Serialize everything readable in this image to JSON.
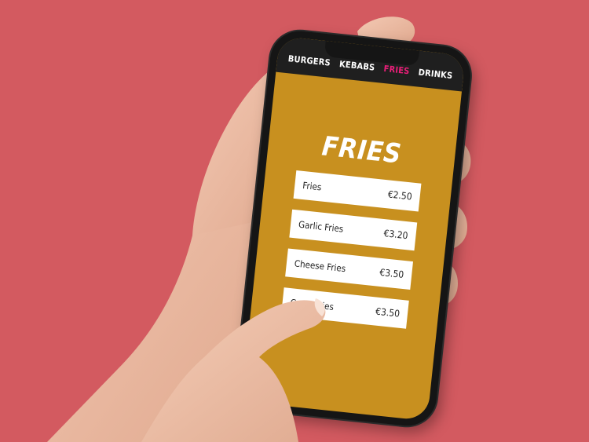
{
  "nav": {
    "items": [
      {
        "label": "BURGERS",
        "active": false
      },
      {
        "label": "KEBABS",
        "active": false
      },
      {
        "label": "FRIES",
        "active": true
      },
      {
        "label": "DRINKS",
        "active": false
      }
    ]
  },
  "page": {
    "title": "FRIES"
  },
  "menu": {
    "items": [
      {
        "name": "Fries",
        "price": "€2.50"
      },
      {
        "name": "Garlic Fries",
        "price": "€3.20"
      },
      {
        "name": "Cheese Fries",
        "price": "€3.50"
      },
      {
        "name": "Curry Fries",
        "price": "€3.50"
      }
    ]
  },
  "colors": {
    "background": "#d35a60",
    "screen": "#c8901f",
    "nav_bg": "#1f1f1f",
    "nav_active": "#e91e78"
  }
}
